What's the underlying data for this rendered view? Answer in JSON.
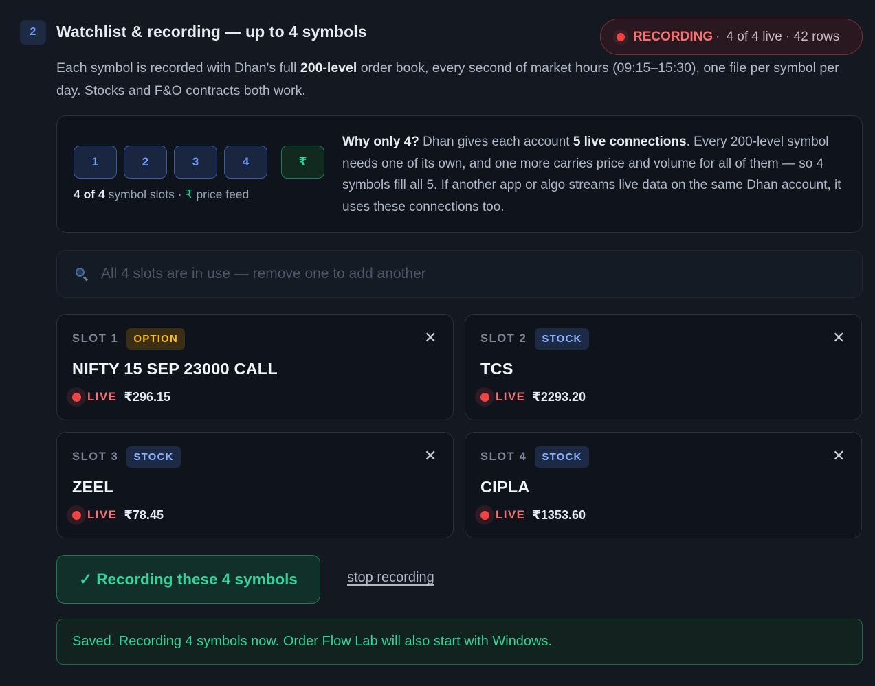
{
  "section": {
    "step_number": "2",
    "title": "Watchlist & recording — up to 4 symbols",
    "description_pre": "Each symbol is recorded with Dhan's full ",
    "description_bold": "200-level",
    "description_post": " order book, every second of market hours (09:15–15:30), one file per symbol per day. Stocks and F&O contracts both work."
  },
  "recording_status": {
    "label": "RECORDING",
    "separator": "·",
    "meta": "4 of 4 live · 42 rows",
    "color": "#ef4444"
  },
  "slot_chips": [
    "1",
    "2",
    "3",
    "4"
  ],
  "price_feed_chip": "₹",
  "slots_caption": {
    "count": "4 of 4",
    "text": " symbol slots · ",
    "rupee": "₹",
    "feed": " price feed"
  },
  "why": {
    "heading": "Why only 4?",
    "part1": " Dhan gives each account ",
    "bold": "5 live connections",
    "part2": ". Every 200-level symbol needs one of its own, and one more carries price and volume for all of them — so 4 symbols fill all 5. If another app or algo streams live data on the same Dhan account, it uses these connections too."
  },
  "search": {
    "placeholder": "All 4 slots are in use — remove one to add another",
    "value": "",
    "icon": "search-icon"
  },
  "slots": [
    {
      "label": "SLOT 1",
      "type": "OPTION",
      "symbol": "NIFTY 15 SEP 23000 CALL",
      "status": "LIVE",
      "price": "₹296.15"
    },
    {
      "label": "SLOT 2",
      "type": "STOCK",
      "symbol": "TCS",
      "status": "LIVE",
      "price": "₹2293.20"
    },
    {
      "label": "SLOT 3",
      "type": "STOCK",
      "symbol": "ZEEL",
      "status": "LIVE",
      "price": "₹78.45"
    },
    {
      "label": "SLOT 4",
      "type": "STOCK",
      "symbol": "CIPLA",
      "status": "LIVE",
      "price": "₹1353.60"
    }
  ],
  "remove_icon": "✕",
  "actions": {
    "record_button": "✓ Recording these 4 symbols",
    "stop_link": "stop recording"
  },
  "saved_message": "Saved. Recording 4 symbols now. Order Flow Lab will also start with Windows.",
  "colors": {
    "background": "#131821",
    "accent_blue": "#6f9bff",
    "live_red": "#ef4444",
    "success_green": "#34d399",
    "option_amber": "#fbbf24"
  }
}
